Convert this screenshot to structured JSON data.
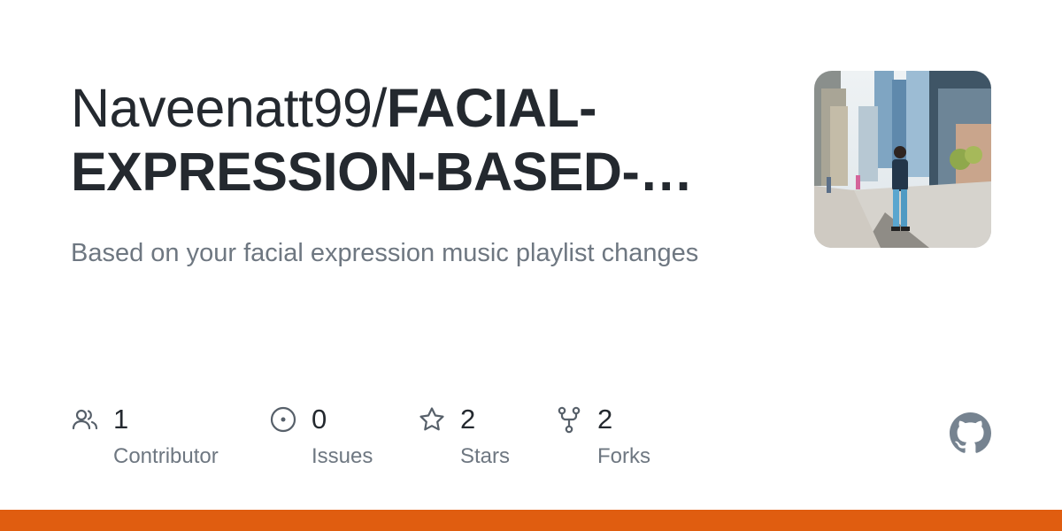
{
  "repo": {
    "owner": "Naveenatt99/",
    "name": "FACIAL-EXPRESSION-BASED-…",
    "description": "Based on your facial expression music playlist changes"
  },
  "stats": [
    {
      "icon": "people-icon",
      "count": "1",
      "label": "Contributor"
    },
    {
      "icon": "issue-opened-icon",
      "count": "0",
      "label": "Issues"
    },
    {
      "icon": "star-icon",
      "count": "2",
      "label": "Stars"
    },
    {
      "icon": "repo-forked-icon",
      "count": "2",
      "label": "Forks"
    }
  ],
  "colors": {
    "title": "#24292f",
    "muted": "#6e7781",
    "icon": "#57606a",
    "language_bar": "#e05d10",
    "github_logo": "#768390"
  }
}
